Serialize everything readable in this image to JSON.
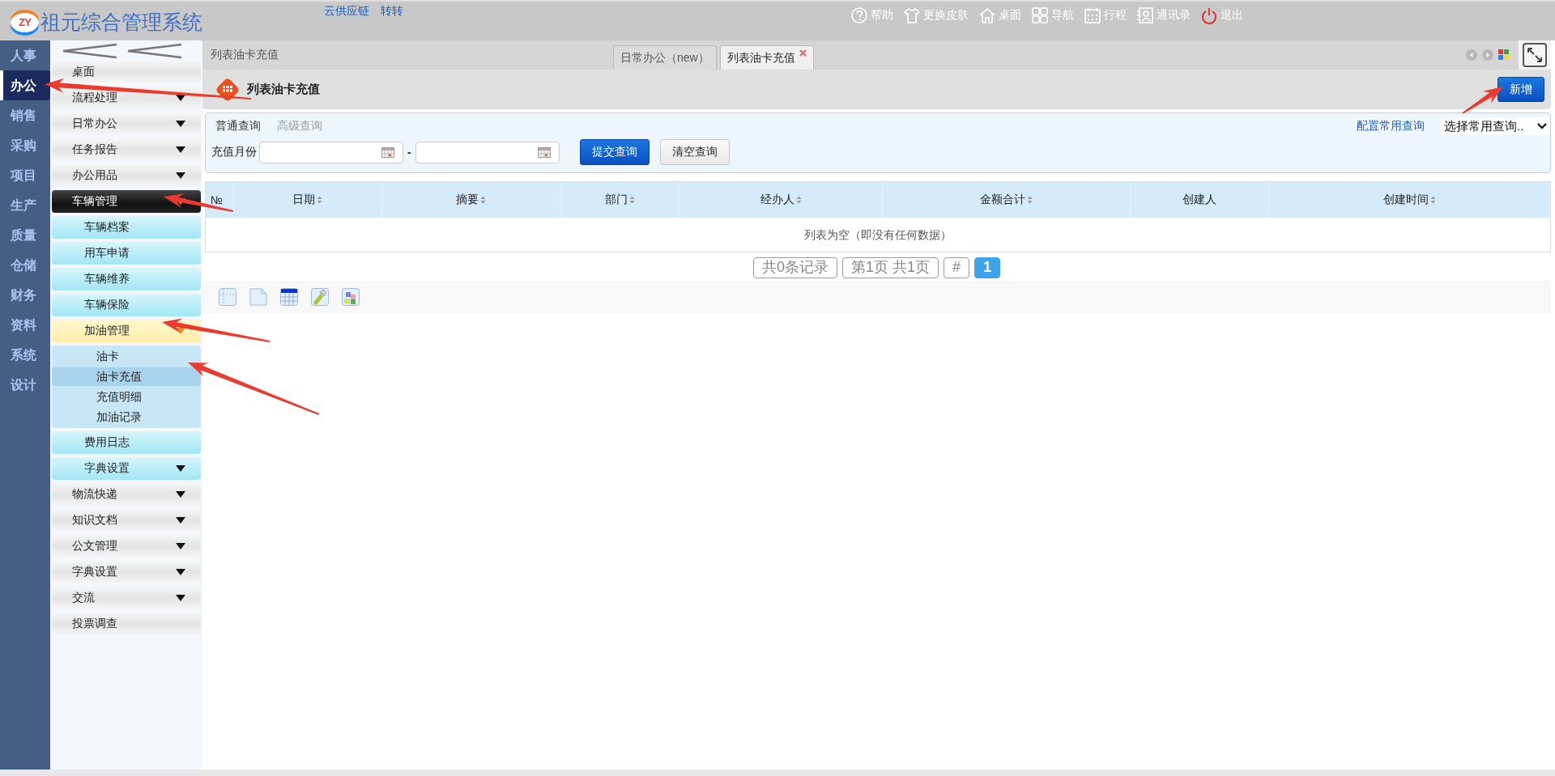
{
  "header": {
    "logo_text": "ZY",
    "title": "祖元综合管理系统",
    "links": [
      {
        "label": "云供应链"
      },
      {
        "label": "转转"
      }
    ],
    "tools": [
      {
        "kind": "help",
        "label": "帮助"
      },
      {
        "kind": "skin",
        "label": "更换皮肤"
      },
      {
        "kind": "home",
        "label": "桌面"
      },
      {
        "kind": "nav",
        "label": "导航"
      },
      {
        "kind": "calendar",
        "label": "行程"
      },
      {
        "kind": "contacts",
        "label": "通讯录"
      },
      {
        "kind": "logout",
        "label": "退出"
      }
    ]
  },
  "nav": [
    {
      "label": "人事",
      "selected": false
    },
    {
      "label": "办公",
      "selected": true
    },
    {
      "label": "销售",
      "selected": false
    },
    {
      "label": "采购",
      "selected": false
    },
    {
      "label": "项目",
      "selected": false
    },
    {
      "label": "生产",
      "selected": false
    },
    {
      "label": "质量",
      "selected": false
    },
    {
      "label": "仓储",
      "selected": false
    },
    {
      "label": "财务",
      "selected": false
    },
    {
      "label": "资料",
      "selected": false
    },
    {
      "label": "系统",
      "selected": false
    },
    {
      "label": "设计",
      "selected": false
    }
  ],
  "sidebar": {
    "items": [
      {
        "kind": "page",
        "label": "桌面",
        "selected": false
      },
      {
        "kind": "group",
        "label": "流程处理",
        "expanded": false
      },
      {
        "kind": "group",
        "label": "日常办公",
        "expanded": false
      },
      {
        "kind": "group",
        "label": "任务报告",
        "expanded": false
      },
      {
        "kind": "group",
        "label": "办公用品",
        "expanded": false
      },
      {
        "kind": "group",
        "label": "车辆管理",
        "expanded": true,
        "children": [
          {
            "kind": "page",
            "label": "车辆档案",
            "selected": false
          },
          {
            "kind": "page",
            "label": "用车申请",
            "selected": false
          },
          {
            "kind": "page",
            "label": "车辆维养",
            "selected": false
          },
          {
            "kind": "page",
            "label": "车辆保险",
            "selected": false
          },
          {
            "kind": "group",
            "label": "加油管理",
            "expanded": true,
            "children": [
              {
                "kind": "page",
                "label": "油卡",
                "selected": false
              },
              {
                "kind": "page",
                "label": "油卡充值",
                "selected": true
              },
              {
                "kind": "page",
                "label": "充值明细",
                "selected": false
              },
              {
                "kind": "page",
                "label": "加油记录",
                "selected": false
              }
            ]
          },
          {
            "kind": "page",
            "label": "费用日志",
            "selected": false
          },
          {
            "kind": "group",
            "label": "字典设置",
            "expanded": false
          }
        ]
      },
      {
        "kind": "group",
        "label": "物流快递",
        "expanded": false
      },
      {
        "kind": "group",
        "label": "知识文档",
        "expanded": false
      },
      {
        "kind": "group",
        "label": "公文管理",
        "expanded": false
      },
      {
        "kind": "group",
        "label": "字典设置",
        "expanded": false
      },
      {
        "kind": "group",
        "label": "交流",
        "expanded": false
      },
      {
        "kind": "page",
        "label": "投票调查",
        "selected": false
      }
    ]
  },
  "tabs_bar": {
    "breadcrumb": "列表油卡充值",
    "tabs": [
      {
        "label": "日常办公（new）",
        "selected": false,
        "closable": false
      },
      {
        "label": "列表油卡充值",
        "selected": true,
        "closable": true
      }
    ]
  },
  "page": {
    "title": "列表油卡充值",
    "add_button": "新增"
  },
  "query": {
    "modes": [
      {
        "label": "普通查询",
        "selected": true
      },
      {
        "label": "高级查询",
        "selected": false
      }
    ],
    "field_label": "充值月份",
    "range_separator": "-",
    "buttons": [
      {
        "kind": "primary",
        "label": "提交查询"
      },
      {
        "kind": "default",
        "label": "清空查询"
      }
    ],
    "config_link": "配置常用查询",
    "saved_select": "选择常用查询.."
  },
  "table": {
    "columns": [
      {
        "label": "№",
        "sortable": false
      },
      {
        "label": "日期",
        "sortable": true
      },
      {
        "label": "摘要",
        "sortable": true
      },
      {
        "label": "部门",
        "sortable": true
      },
      {
        "label": "经办人",
        "sortable": true
      },
      {
        "label": "金额合计",
        "sortable": true
      },
      {
        "label": "创建人",
        "sortable": false
      },
      {
        "label": "创建时间",
        "sortable": true
      }
    ],
    "empty_message": "列表为空（即没有任何数据）"
  },
  "pager": {
    "total": "共0条记录",
    "pages": "第1页 共1页",
    "jump": "#",
    "page_buttons": [
      {
        "label": "1",
        "selected": true
      }
    ]
  },
  "toolbar": [
    {
      "kind": "grid"
    },
    {
      "kind": "page"
    },
    {
      "kind": "table"
    },
    {
      "kind": "wrench"
    },
    {
      "kind": "puzzle"
    }
  ]
}
